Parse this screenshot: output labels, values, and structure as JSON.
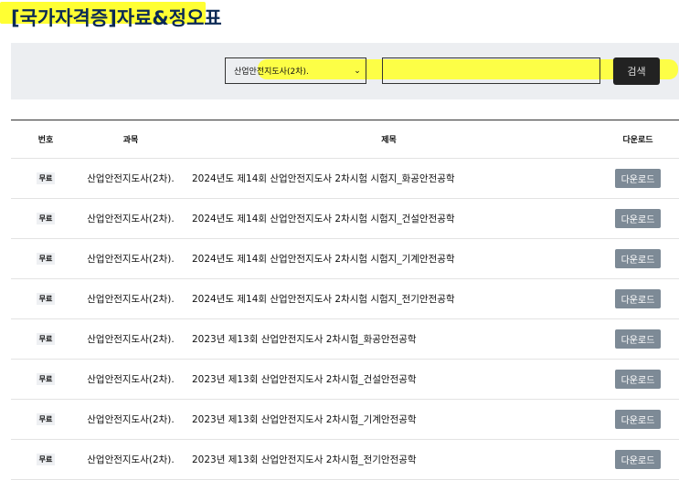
{
  "page": {
    "title": "[국가자격증]자료&정오표"
  },
  "search": {
    "select_value": "산업안전지도사(2차).",
    "input_value": "",
    "button_label": "검색"
  },
  "table": {
    "headers": {
      "no": "번호",
      "subject": "과목",
      "title": "제목",
      "download": "다운로드"
    },
    "rows": [
      {
        "badge": "무료",
        "subject": "산업안전지도사(2차).",
        "title": "2024년도 제14회 산업안전지도사 2차시험 시험지_화공안전공학",
        "download": "다운로드"
      },
      {
        "badge": "무료",
        "subject": "산업안전지도사(2차).",
        "title": "2024년도 제14회 산업안전지도사 2차시험 시험지_건설안전공학",
        "download": "다운로드"
      },
      {
        "badge": "무료",
        "subject": "산업안전지도사(2차).",
        "title": "2024년도 제14회 산업안전지도사 2차시험 시험지_기계안전공학",
        "download": "다운로드"
      },
      {
        "badge": "무료",
        "subject": "산업안전지도사(2차).",
        "title": "2024년도 제14회 산업안전지도사 2차시험 시험지_전기안전공학",
        "download": "다운로드"
      },
      {
        "badge": "무료",
        "subject": "산업안전지도사(2차).",
        "title": "2023년 제13회 산업안전지도사 2차시험_화공안전공학",
        "download": "다운로드"
      },
      {
        "badge": "무료",
        "subject": "산업안전지도사(2차).",
        "title": "2023년 제13회 산업안전지도사 2차시험_건설안전공학",
        "download": "다운로드"
      },
      {
        "badge": "무료",
        "subject": "산업안전지도사(2차).",
        "title": "2023년 제13회 산업안전지도사 2차시험_기계안전공학",
        "download": "다운로드"
      },
      {
        "badge": "무료",
        "subject": "산업안전지도사(2차).",
        "title": "2023년 제13회 산업안전지도사 2차시험_전기안전공학",
        "download": "다운로드"
      }
    ]
  },
  "colors": {
    "highlight": "#ffff33",
    "title": "#0b2a55",
    "download_button": "#7d8a96",
    "search_button": "#222222"
  }
}
